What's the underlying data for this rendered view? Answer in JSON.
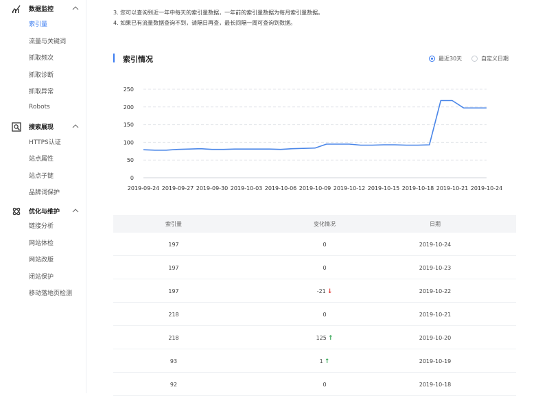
{
  "sidebar": {
    "groups": [
      {
        "title": "数据监控",
        "icon": "bar-chart-icon",
        "items": [
          "索引量",
          "流量与关键词",
          "抓取频次",
          "抓取诊断",
          "抓取异常",
          "Robots"
        ]
      },
      {
        "title": "搜索展现",
        "icon": "search-display-icon",
        "items": [
          "HTTPS认证",
          "站点属性",
          "站点子链",
          "品牌词保护"
        ]
      },
      {
        "title": "优化与维护",
        "icon": "maintenance-icon",
        "items": [
          "链接分析",
          "网站体检",
          "网站改版",
          "闭站保护",
          "移动落地页检测"
        ]
      }
    ],
    "active_item": "索引量"
  },
  "notes": {
    "line3": "3. 您可以查询到近一年中每天的索引量数据，一年前的索引量数据为每月索引量数据。",
    "line4": "4. 如果已有流量数据查询不到，请隔日再查，最长间隔一周可查询到数据。"
  },
  "section": {
    "title": "索引情况",
    "radio_recent": "最近30天",
    "radio_custom": "自定义日期",
    "selected": "最近30天"
  },
  "colors": {
    "accent": "#3a7bf0",
    "up": "#2ea44f",
    "down": "#e0302c"
  },
  "chart_data": {
    "type": "line",
    "ylim": [
      0,
      250
    ],
    "yticks": [
      "0",
      "50",
      "100",
      "150",
      "200",
      "250"
    ],
    "xtick_labels": [
      "2019-09-24",
      "2019-09-27",
      "2019-09-30",
      "2019-10-03",
      "2019-10-06",
      "2019-10-09",
      "2019-10-12",
      "2019-10-15",
      "2019-10-18",
      "2019-10-21",
      "2019-10-24"
    ],
    "x": [
      "2019-09-24",
      "2019-09-25",
      "2019-09-26",
      "2019-09-27",
      "2019-09-28",
      "2019-09-29",
      "2019-09-30",
      "2019-10-01",
      "2019-10-02",
      "2019-10-03",
      "2019-10-04",
      "2019-10-05",
      "2019-10-06",
      "2019-10-07",
      "2019-10-08",
      "2019-10-09",
      "2019-10-10",
      "2019-10-11",
      "2019-10-12",
      "2019-10-13",
      "2019-10-14",
      "2019-10-15",
      "2019-10-16",
      "2019-10-17",
      "2019-10-18",
      "2019-10-19",
      "2019-10-20",
      "2019-10-21",
      "2019-10-22",
      "2019-10-23",
      "2019-10-24"
    ],
    "values": [
      79,
      78,
      78,
      80,
      81,
      82,
      80,
      80,
      81,
      81,
      81,
      81,
      80,
      82,
      83,
      84,
      95,
      95,
      95,
      92,
      92,
      93,
      93,
      92,
      92,
      93,
      218,
      218,
      197,
      197,
      197
    ],
    "grid": true,
    "line_color": "#4a86e8"
  },
  "table": {
    "headers": [
      "索引量",
      "变化情况",
      "日期"
    ],
    "rows": [
      {
        "count": "197",
        "change": "0",
        "trend": "",
        "date": "2019-10-24"
      },
      {
        "count": "197",
        "change": "0",
        "trend": "",
        "date": "2019-10-23"
      },
      {
        "count": "197",
        "change": "-21",
        "trend": "down",
        "date": "2019-10-22"
      },
      {
        "count": "218",
        "change": "0",
        "trend": "",
        "date": "2019-10-21"
      },
      {
        "count": "218",
        "change": "125",
        "trend": "up",
        "date": "2019-10-20"
      },
      {
        "count": "93",
        "change": "1",
        "trend": "up",
        "date": "2019-10-19"
      },
      {
        "count": "92",
        "change": "0",
        "trend": "",
        "date": "2019-10-18"
      }
    ]
  }
}
